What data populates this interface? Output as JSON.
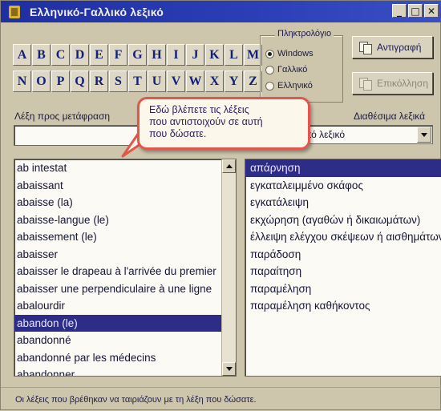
{
  "window": {
    "title": "Ελληνικό-Γαλλικό λεξικό",
    "controls": {
      "minimize": "_",
      "maximize": "□",
      "close": "✕"
    }
  },
  "letters": {
    "row1": [
      "A",
      "B",
      "C",
      "D",
      "E",
      "F",
      "G",
      "H",
      "I",
      "J",
      "K",
      "L",
      "M"
    ],
    "row2": [
      "N",
      "O",
      "P",
      "Q",
      "R",
      "S",
      "T",
      "U",
      "V",
      "W",
      "X",
      "Y",
      "Z"
    ]
  },
  "keyboard": {
    "title": "Πληκτρολόγιο",
    "options": [
      {
        "label": "Windows",
        "selected": true
      },
      {
        "label": "Γαλλικό",
        "selected": false
      },
      {
        "label": "Ελληνικό",
        "selected": false
      }
    ]
  },
  "buttons": {
    "copy_label": "Αντιγραφή",
    "paste_label": "Επικόλληση"
  },
  "labels": {
    "word_to_translate": "Λέξη προς μετάφραση",
    "available_dictionaries": "Διαθέσιμα λεξικά"
  },
  "input": {
    "value": ""
  },
  "dictionary_select": {
    "selected": "Γαλλικό λεξικό"
  },
  "callout": {
    "line1": "Εδώ βλέπετε τις λέξεις",
    "line2": "που αντιστοιχούν σε αυτή",
    "line3": "που δώσατε."
  },
  "left_list": {
    "items": [
      "ab intestat",
      "abaissant",
      "abaisse (la)",
      "abaisse-langue (le)",
      "abaissement (le)",
      "abaisser",
      "abaisser le drapeau à l'arrivée du premier",
      "abaisser une perpendiculaire à une ligne",
      "abalourdir",
      "abandon (le)",
      "abandonné",
      "abandonné par les médecins",
      "abandonner"
    ],
    "selected_index": 9
  },
  "right_list": {
    "items": [
      "απάρνηση",
      "εγκαταλειμμένο σκάφος",
      "εγκατάλειψη",
      "εκχώρηση (αγαθών ή δικαιωμάτων)",
      "έλλειψη ελέγχου σκέψεων ή αισθημάτων",
      "παράδοση",
      "παραίτηση",
      "παραμέληση",
      "παραμέληση καθήκοντος"
    ],
    "selected_index": 0
  },
  "status": {
    "text": "Οι λέξεις που βρέθηκαν να ταιριάζουν με τη λέξη που δώσατε."
  },
  "colors": {
    "title_bar": "#2c3fb8",
    "selection": "#2d2c87",
    "callout_border": "#e2574c",
    "letter_text": "#12207a"
  }
}
